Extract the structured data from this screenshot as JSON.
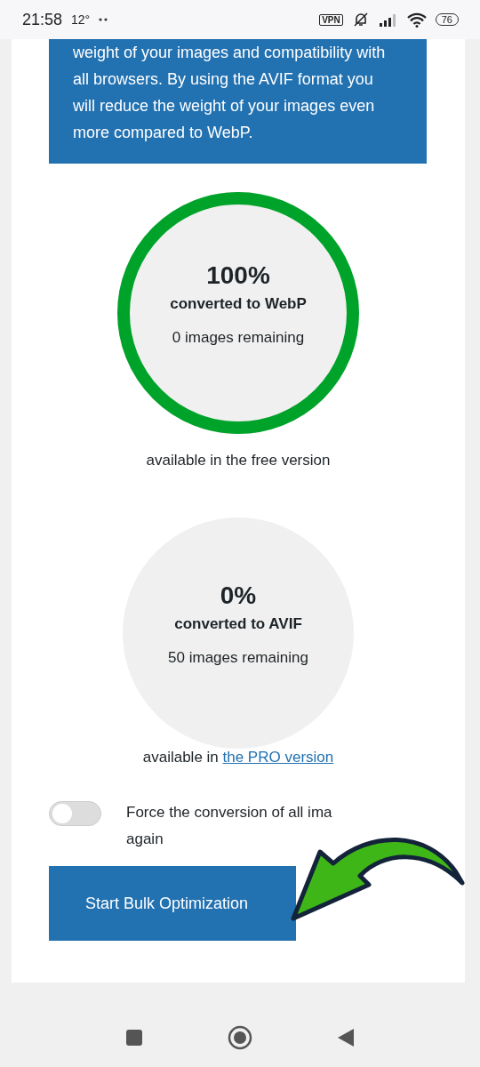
{
  "status_bar": {
    "time": "21:58",
    "temperature": "12°",
    "vpn": "VPN",
    "battery": "76"
  },
  "info_panel": {
    "text": "weight of your images and compatibility with all browsers. By using the AVIF format you will reduce the weight of your images even more compared to WebP."
  },
  "meters": [
    {
      "percent": "100%",
      "label": "converted to WebP",
      "remaining": "0 images remaining",
      "level": 1,
      "note": "available in the free version"
    },
    {
      "percent": "0%",
      "label": "converted to AVIF",
      "remaining": "50 images remaining",
      "level": 0,
      "note_prefix": "available in ",
      "note_link": "the PRO version"
    }
  ],
  "force_toggle": {
    "on": false,
    "label": "Force the conversion of all ima\nagain"
  },
  "start_button": {
    "label": "Start Bulk Optimization"
  }
}
